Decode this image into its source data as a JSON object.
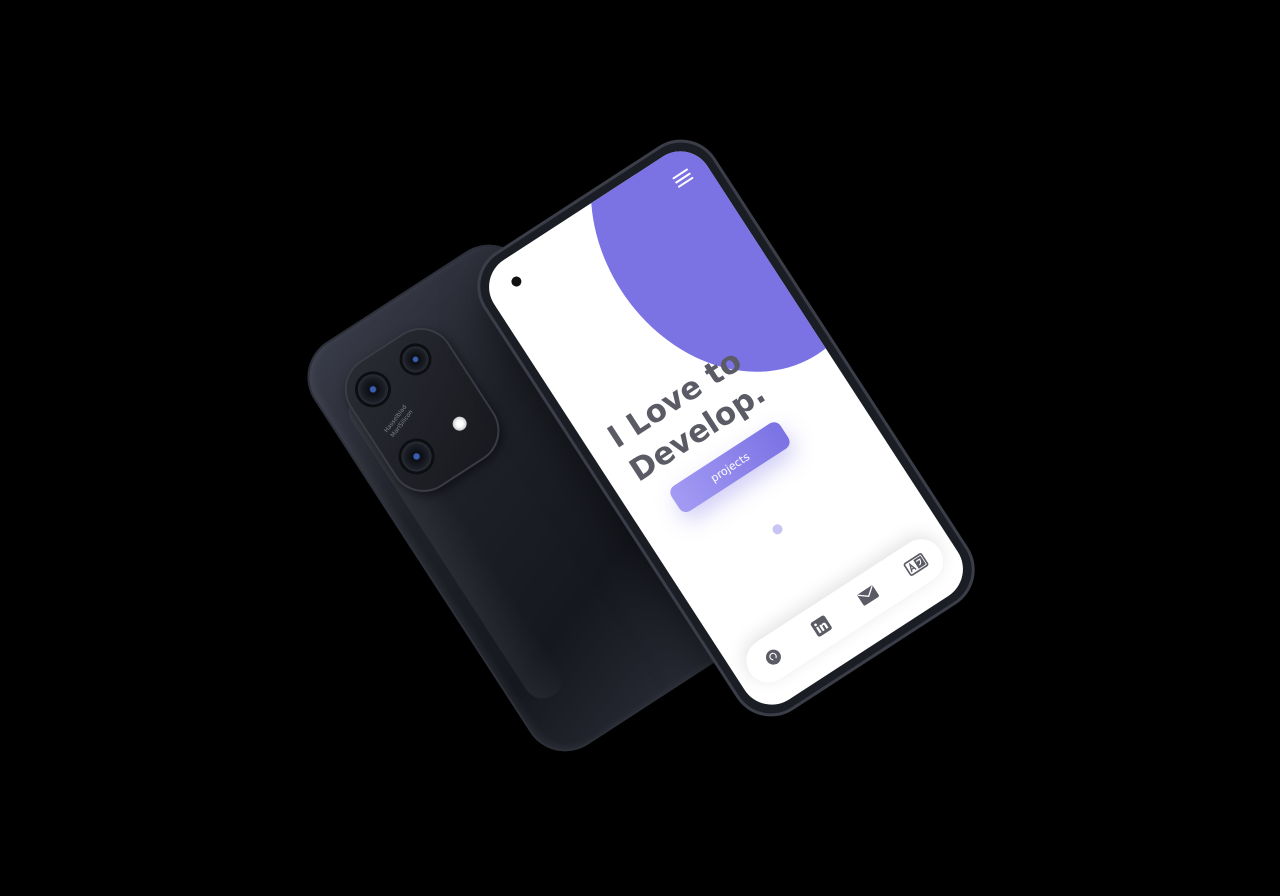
{
  "app": {
    "hero_line_1": "I Love to",
    "hero_line_2": "Develop.",
    "cta_label": "projects",
    "menu_icon": "hamburger-menu-icon"
  },
  "back_phone": {
    "camera_text_1": "Hasselblad",
    "camera_text_2": "MariSilicon"
  },
  "bottom_nav": {
    "items": [
      {
        "icon": "github-icon"
      },
      {
        "icon": "linkedin-icon"
      },
      {
        "icon": "mail-icon"
      },
      {
        "icon": "translate-icon"
      }
    ]
  },
  "colors": {
    "accent": "#7b72e4",
    "accent_light": "#a39bf3",
    "text": "#5b5b66",
    "background": "#000000",
    "screen": "#ffffff"
  }
}
